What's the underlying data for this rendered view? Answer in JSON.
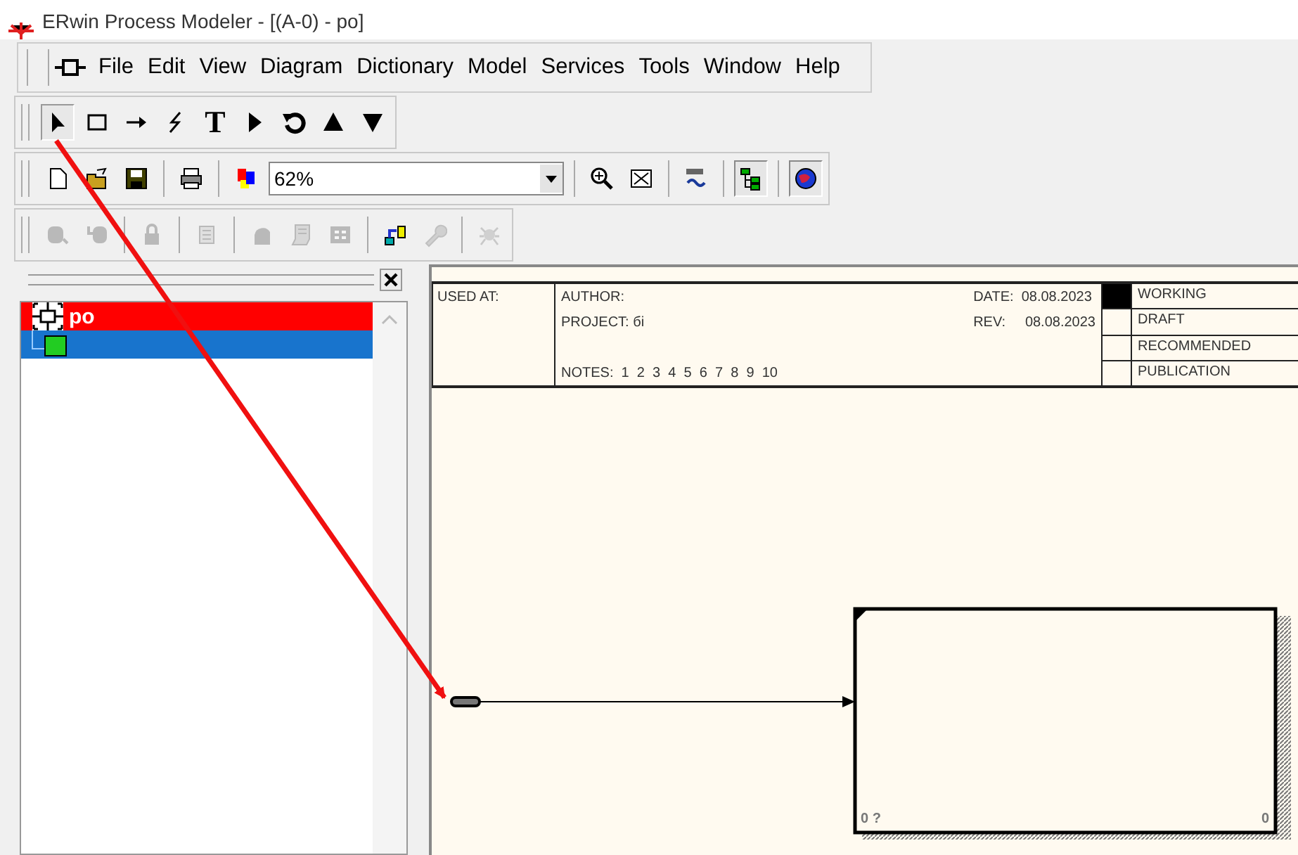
{
  "window": {
    "title": "ERwin Process Modeler - [(A-0)  - po]"
  },
  "menu": [
    "File",
    "Edit",
    "View",
    "Diagram",
    "Dictionary",
    "Model",
    "Services",
    "Tools",
    "Window",
    "Help"
  ],
  "tool_palette": [
    {
      "kind": "pointer",
      "selected": true
    },
    {
      "kind": "box",
      "selected": false
    },
    {
      "kind": "arrow",
      "selected": false
    },
    {
      "kind": "squiggle",
      "selected": false
    },
    {
      "kind": "text",
      "label": "T",
      "selected": false
    },
    {
      "kind": "play",
      "selected": false
    },
    {
      "kind": "rotate",
      "selected": false
    },
    {
      "kind": "up",
      "selected": false
    },
    {
      "kind": "down",
      "selected": false
    }
  ],
  "standard_toolbar": {
    "zoom": "62%",
    "items": [
      {
        "kind": "new",
        "pressed": false
      },
      {
        "kind": "open",
        "pressed": false
      },
      {
        "kind": "save",
        "pressed": false
      },
      {
        "kind": "print",
        "pressed": false
      },
      {
        "kind": "colors",
        "pressed": false
      },
      {
        "kind": "zoom",
        "pressed": false
      },
      {
        "kind": "fit",
        "pressed": false
      },
      {
        "kind": "spell",
        "pressed": false
      },
      {
        "kind": "tree",
        "pressed": true
      },
      {
        "kind": "globe",
        "pressed": true
      }
    ]
  },
  "model_toolbar": [
    {
      "kind": "entity",
      "disabled": true
    },
    {
      "kind": "entity2",
      "disabled": true
    },
    {
      "kind": "lock",
      "disabled": true
    },
    {
      "kind": "doc",
      "disabled": true
    },
    {
      "kind": "head",
      "disabled": true
    },
    {
      "kind": "scroll",
      "disabled": true
    },
    {
      "kind": "grid",
      "disabled": true
    },
    {
      "kind": "connect",
      "disabled": false
    },
    {
      "kind": "wrench",
      "disabled": true
    },
    {
      "kind": "bug",
      "disabled": true
    }
  ],
  "tree": {
    "label": "po",
    "highlighted": true,
    "selected": false,
    "children": [
      {
        "selected": true
      }
    ]
  },
  "title_block": {
    "used_at": "USED AT:",
    "author": "AUTHOR:",
    "project": "PROJECT:  бі",
    "notes": "NOTES:  1  2  3  4  5  6  7  8  9  10",
    "date": "DATE:  08.08.2023",
    "rev": "REV:     08.08.2023",
    "statuses": [
      {
        "label": "WORKING",
        "selected": true
      },
      {
        "label": "DRAFT",
        "selected": false
      },
      {
        "label": "RECOMMENDED",
        "selected": false
      },
      {
        "label": "PUBLICATION",
        "selected": false
      }
    ]
  },
  "diagram": {
    "box": {
      "cost": "0 ?",
      "number": "0"
    }
  }
}
